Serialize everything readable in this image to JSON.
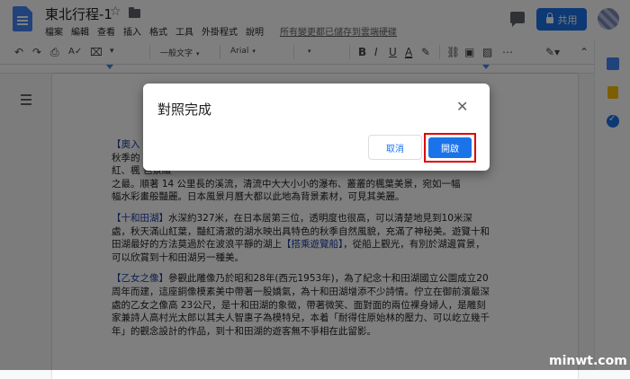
{
  "header": {
    "doc_title": "東北行程-1",
    "menu": [
      "檔案",
      "編輯",
      "查看",
      "插入",
      "格式",
      "工具",
      "外掛程式",
      "說明"
    ],
    "save_notice": "所有變更都已儲存到雲端硬碟",
    "share_label": "共用"
  },
  "toolbar": {
    "style": "一般文字",
    "font": "Arial"
  },
  "document": {
    "p1_title": "【奧入",
    "p1_text": "秋季的                             觀季",
    "p1_l2": "紅、楓                        色景緻",
    "p1_l3": "之最。順著 14 公里長的溪流，清流中大大小小的瀑布、叢叢的楓葉美景，宛如一幅",
    "p1_l4": "幅水彩畫般豔麗。日本風景月曆大都以此地為背景素材，可見其美麗。",
    "p2_title": "【十和田湖】",
    "p2_text": "水深約327米，在日本居第三位，透明度也很高，可以清楚地見到10米深處，秋天滿山紅葉，豔紅清澈的湖水映出具特色的秋季自然風貌，充滿了神秘美。遊覽十和田湖最好的方法莫過於在波浪平靜的湖上",
    "p2_link": "【搭乘遊覽船】",
    "p2_text2": "，從船上觀光，有別於湖邊賞景，可以欣賞到十和田湖另一種美。",
    "p3_title": "【乙女之像】",
    "p3_text": "參觀此雕像乃於昭和28年(西元1953年)，為了紀念十和田湖國立公園成立20周年而建，這座銅像模素美中帶著一股嬌氣，為十和田湖增添不少詩情。佇立在御前濱最深處的乙女之像高 23公尺，是十和田湖的象徵，帶著微笑、面對面的兩位裸身婦人，是雕刻家兼詩人高村光太郎以其夫人智惠子為模特兒，本着「耐得住原始林的壓力、可以屹立幾千年」的觀念設計的作品，到十和田湖的遊客無不爭相在此留影。"
  },
  "dialog": {
    "title": "對照完成",
    "cancel_label": "取消",
    "open_label": "開啟"
  },
  "watermark": "minwt.com"
}
